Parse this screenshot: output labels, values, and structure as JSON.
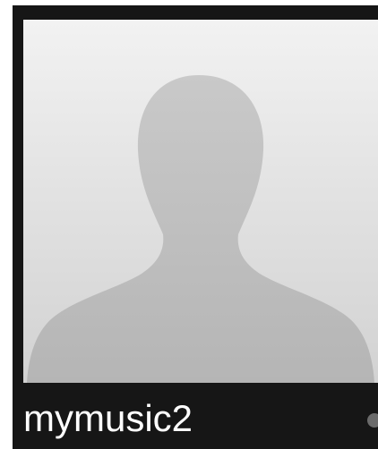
{
  "profile": {
    "username": "mymusic2",
    "avatar_icon": "default-person-silhouette-icon",
    "status_icon": "status-dot-icon"
  },
  "colors": {
    "card_background": "#161616",
    "avatar_background": "#e3e3e3",
    "silhouette": "#bdbdbd",
    "username_text": "#ffffff",
    "status_dot": "#6b6b6b"
  }
}
